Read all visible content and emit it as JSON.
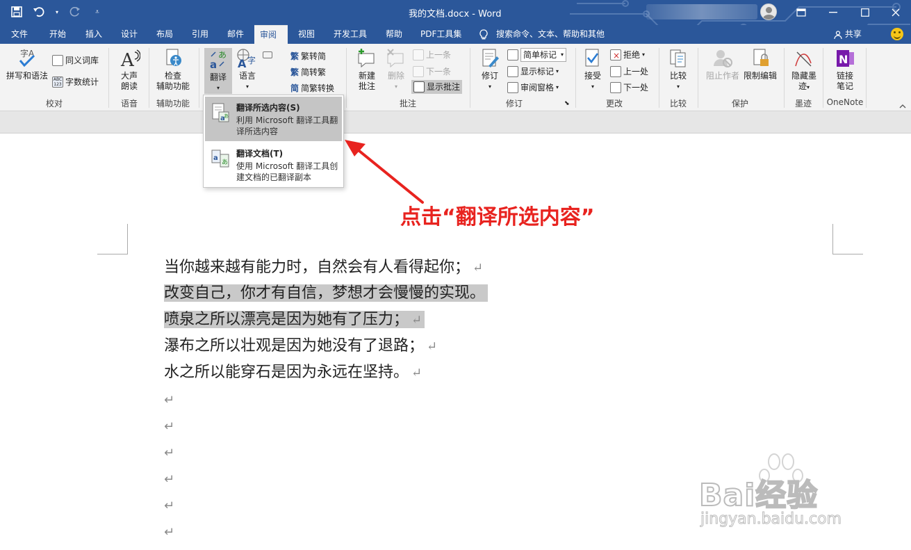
{
  "titlebar": {
    "doc_title": "我的文档.docx  -  Word",
    "bg_color": "#2b579a"
  },
  "tabs": [
    {
      "label": "文件"
    },
    {
      "label": "开始"
    },
    {
      "label": "插入"
    },
    {
      "label": "设计"
    },
    {
      "label": "布局"
    },
    {
      "label": "引用"
    },
    {
      "label": "邮件"
    },
    {
      "label": "审阅",
      "active": true
    },
    {
      "label": "视图"
    },
    {
      "label": "开发工具"
    },
    {
      "label": "帮助"
    },
    {
      "label": "PDF工具集"
    }
  ],
  "tell_me": "搜索命令、文本、帮助和其他",
  "share": "共享",
  "ribbon": {
    "proofing": {
      "spelling": "拼写和语法",
      "thesaurus": "同义词库",
      "word_count": "字数统计",
      "group": "校对"
    },
    "speech": {
      "read_aloud_1": "大声",
      "read_aloud_2": "朗读",
      "group": "语音"
    },
    "accessibility": {
      "check_1": "检查",
      "check_2": "辅助功能",
      "group": "辅助功能"
    },
    "language": {
      "translate": "翻译",
      "language": "语言",
      "trad_to_simp": "繁转简",
      "simp_to_trad": "简转繁",
      "convert": "简繁转换"
    },
    "comments": {
      "new_1": "新建",
      "new_2": "批注",
      "delete": "删除",
      "prev": "上一条",
      "next": "下一条",
      "show": "显示批注",
      "group": "批注"
    },
    "tracking": {
      "track": "修订",
      "markup": "简单标记",
      "show_markup": "显示标记",
      "pane": "审阅窗格",
      "group": "修订"
    },
    "changes": {
      "accept": "接受",
      "reject": "拒绝",
      "prev": "上一处",
      "next": "下一处",
      "group": "更改"
    },
    "compare": {
      "compare": "比较",
      "group": "比较"
    },
    "protect": {
      "block": "阻止作者",
      "restrict": "限制编辑",
      "group": "保护"
    },
    "ink": {
      "hide_1": "隐藏墨",
      "hide_2": "迹",
      "group": "墨迹"
    },
    "onenote": {
      "link_1": "链接",
      "link_2": "笔记",
      "group": "OneNote"
    }
  },
  "menu": {
    "item1_title": "翻译所选内容(S)",
    "item1_desc": "利用 Microsoft 翻译工具翻译所选内容",
    "item2_title": "翻译文档(T)",
    "item2_desc": "使用 Microsoft 翻译工具创建文档的已翻译副本"
  },
  "document": {
    "lines": [
      "当你越来越有能力时，自然会有人看得起你；",
      "改变自己，你才有自信，梦想才会慢慢的实现。",
      "喷泉之所以漂亮是因为她有了压力；",
      "瀑布之所以壮观是因为她没有了退路；",
      "水之所以能穿石是因为永远在坚持。"
    ],
    "para_mark": "↵",
    "highlight_color": "#c9c9c9"
  },
  "annotation": {
    "text": "点击“翻译所选内容”",
    "color": "#e8231f"
  },
  "watermark": {
    "main": "Bai经验",
    "sub": "jingyan.baidu.com"
  }
}
